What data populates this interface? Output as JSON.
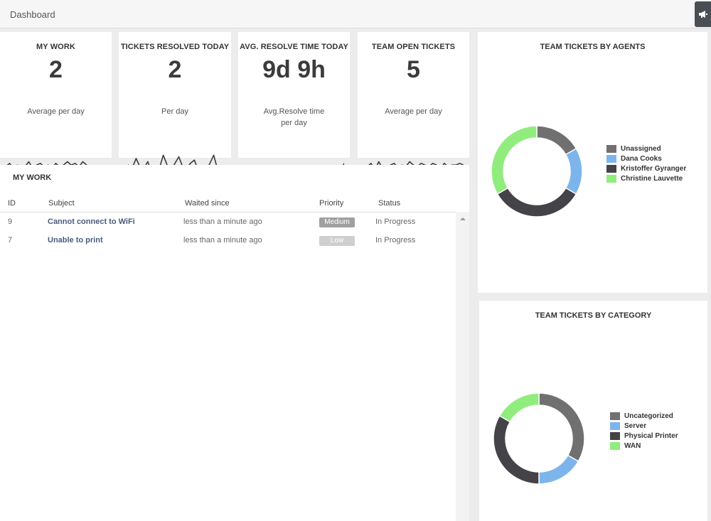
{
  "header": {
    "title": "Dashboard"
  },
  "kpis": [
    {
      "title": "MY WORK",
      "value": "2",
      "subtitle": "Average per day",
      "spark": [
        5,
        7,
        4,
        6,
        5,
        5,
        8,
        4,
        6,
        7,
        5,
        6,
        4,
        7,
        5,
        6,
        8,
        6,
        7,
        5,
        8,
        6,
        3,
        5,
        4,
        2,
        2
      ]
    },
    {
      "title": "TICKETS RESOLVED TODAY",
      "value": "2",
      "subtitle": "Per day",
      "spark": [
        3,
        6,
        4,
        10,
        5,
        4,
        8,
        2,
        5,
        4,
        12,
        6,
        3,
        7,
        11,
        5,
        4,
        7,
        9,
        3,
        5,
        2,
        7,
        12,
        3,
        2,
        4
      ]
    },
    {
      "title": "AVG. RESOLVE TIME TODAY",
      "value": "9d 9h",
      "subtitle": "Avg.Resolve time\nper day",
      "spark": [
        2,
        2,
        2,
        2,
        2,
        2,
        2,
        2,
        2,
        2,
        2,
        2,
        2,
        2,
        2,
        2,
        2,
        2,
        2,
        2,
        2,
        2,
        2,
        2,
        2,
        2,
        7
      ]
    },
    {
      "title": "TEAM OPEN TICKETS",
      "value": "5",
      "subtitle": "Average per day",
      "spark": [
        4,
        5,
        7,
        3,
        8,
        4,
        3,
        6,
        7,
        4,
        6,
        5,
        8,
        6,
        5,
        7,
        6,
        5,
        7,
        6,
        4,
        7,
        5,
        6,
        6,
        7,
        6
      ]
    }
  ],
  "my_work": {
    "title": "MY WORK",
    "columns": [
      "ID",
      "Subject",
      "Waited since",
      "Priority",
      "Status"
    ],
    "rows": [
      {
        "id": "9",
        "subject": "Cannot connect to WiFi",
        "waited": "less than a minute ago",
        "priority": "Medium",
        "status": "In Progress"
      },
      {
        "id": "7",
        "subject": "Unable to print",
        "waited": "less than a minute ago",
        "priority": "Low",
        "status": "In Progress"
      }
    ]
  },
  "agents_panel": {
    "title": "TEAM TICKETS BY AGENTS"
  },
  "category_panel": {
    "title": "TEAM TICKETS BY CATEGORY"
  },
  "chart_data": [
    {
      "type": "pie",
      "title": "TEAM TICKETS BY AGENTS",
      "donut": true,
      "categories": [
        "Unassigned",
        "Dana Cooks",
        "Kristoffer Gyranger",
        "Christine Lauvette"
      ],
      "values": [
        1,
        1,
        2,
        2
      ],
      "colors": [
        "#707070",
        "#7cb5ec",
        "#434348",
        "#90ed7d"
      ],
      "legend_position": "right"
    },
    {
      "type": "pie",
      "title": "TEAM TICKETS BY CATEGORY",
      "donut": true,
      "categories": [
        "Uncategorized",
        "Server",
        "Physical Printer",
        "WAN"
      ],
      "values": [
        3,
        1.5,
        3,
        1.5
      ],
      "colors": [
        "#707070",
        "#7cb5ec",
        "#434348",
        "#90ed7d"
      ],
      "legend_position": "right"
    }
  ]
}
